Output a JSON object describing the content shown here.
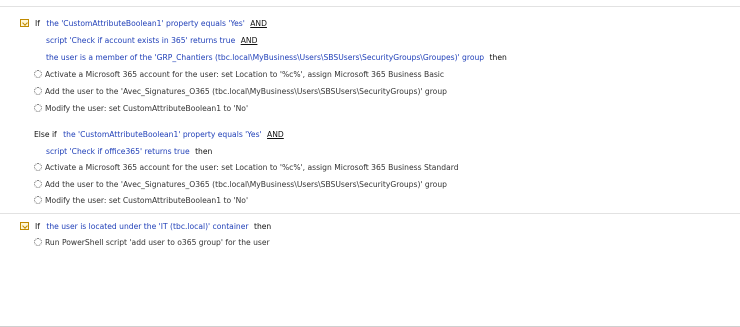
{
  "blocks": [
    {
      "if_label": "If",
      "cond1": {
        "text": "the 'CustomAttributeBoolean1' property equals 'Yes'",
        "op": "AND"
      },
      "cond2": {
        "text": "script 'Check if account exists in 365' returns true",
        "op": "AND"
      },
      "cond3": {
        "text": "the user is a member of the 'GRP_Chantiers (tbc.local\\MyBusiness\\Users\\SBSUsers\\SecurityGroups\\Groupes)' group",
        "then": "then"
      },
      "actions": [
        "Activate a Microsoft 365 account for the user: set Location to '%c%', assign Microsoft 365 Business Basic",
        "Add the user to the 'Avec_Signatures_O365 (tbc.local\\MyBusiness\\Users\\SBSUsers\\SecurityGroups)' group",
        "Modify the user: set CustomAttributeBoolean1 to 'No'"
      ],
      "else_if_label": "Else if",
      "elif_cond1": {
        "text": "the 'CustomAttributeBoolean1' property equals 'Yes'",
        "op": "AND"
      },
      "elif_cond2": {
        "text": "script 'Check if office365' returns true",
        "then": "then"
      },
      "elif_actions": [
        "Activate a Microsoft 365 account for the user: set Location to '%c%', assign Microsoft 365 Business Standard",
        "Add the user to the 'Avec_Signatures_O365 (tbc.local\\MyBusiness\\Users\\SBSUsers\\SecurityGroups)' group",
        "Modify the user: set CustomAttributeBoolean1 to 'No'"
      ]
    },
    {
      "if_label": "If",
      "cond1": {
        "text": "the user is located under the 'IT (tbc.local)' container",
        "then": "then"
      },
      "actions": [
        "Run PowerShell script 'add user to o365 group' for the user"
      ]
    }
  ],
  "colors": {
    "link": "#1f3fb8",
    "icon": "#c08a00"
  }
}
